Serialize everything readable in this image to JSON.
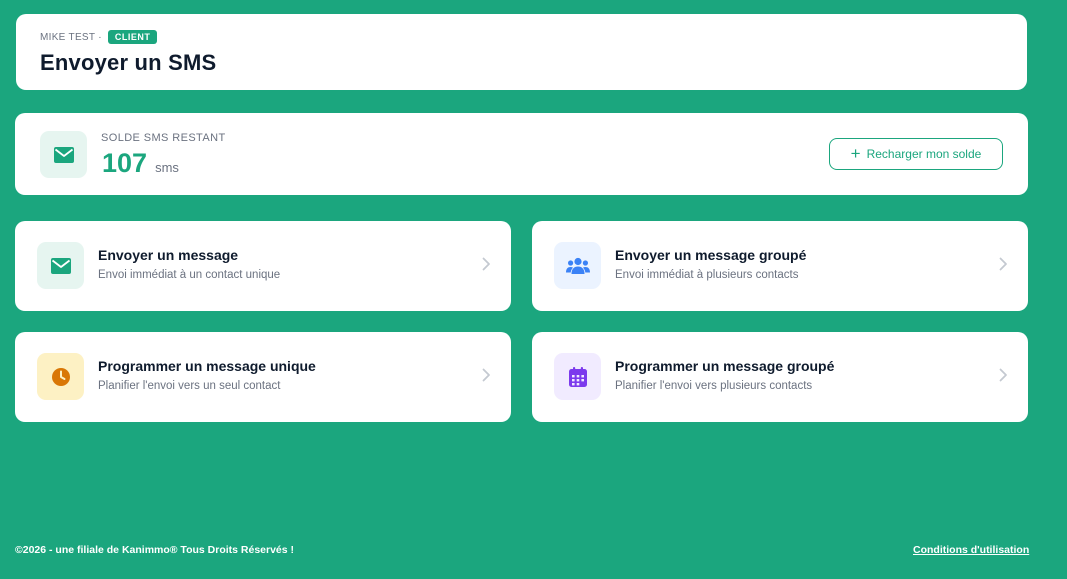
{
  "header": {
    "breadcrumb_user": "MIKE TEST ·",
    "badge": "CLIENT",
    "title": "Envoyer un SMS"
  },
  "balance": {
    "label": "SOLDE SMS RESTANT",
    "value": "107",
    "unit": "sms",
    "recharge_label": "Recharger mon solde"
  },
  "actions": [
    {
      "title": "Envoyer un message",
      "desc": "Envoi immédiat à un contact unique",
      "icon": "envelope-icon",
      "color": "#1ba67e"
    },
    {
      "title": "Envoyer un message groupé",
      "desc": "Envoi immédiat à plusieurs contacts",
      "icon": "users-icon",
      "color": "#3b82f6"
    },
    {
      "title": "Programmer un message unique",
      "desc": "Planifier l'envoi vers un seul contact",
      "icon": "clock-icon",
      "color": "#d97706"
    },
    {
      "title": "Programmer un message groupé",
      "desc": "Planifier l'envoi vers plusieurs contacts",
      "icon": "calendar-icon",
      "color": "#7c3aed"
    }
  ],
  "footer": {
    "copyright": "©2026 - une filiale de Kanimmo® Tous Droits Réservés !",
    "terms_link": "Conditions d'utilisation"
  },
  "colors": {
    "brand": "#1ba67e",
    "text_dark": "#0f1b2d",
    "text_muted": "#6b7280"
  }
}
